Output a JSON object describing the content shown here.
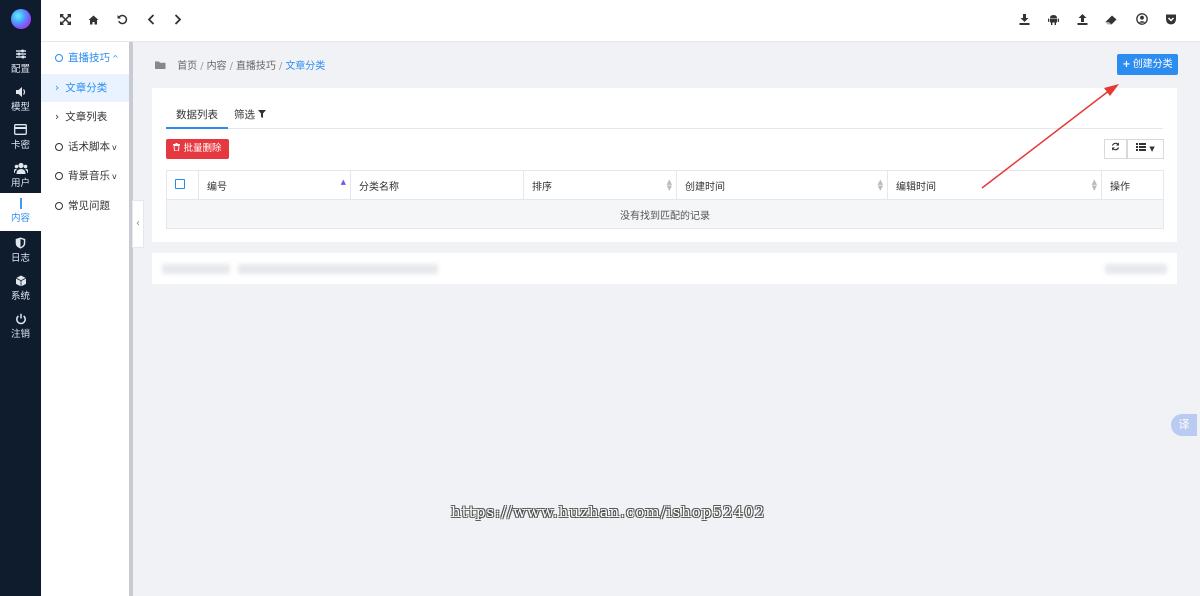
{
  "rail": {
    "items": [
      {
        "label": "配置",
        "icon": "sliders-icon"
      },
      {
        "label": "模型",
        "icon": "speaker-icon"
      },
      {
        "label": "卡密",
        "icon": "card-icon"
      },
      {
        "label": "用户",
        "icon": "users-icon"
      },
      {
        "label": "内容",
        "icon": "pen-icon"
      },
      {
        "label": "日志",
        "icon": "shield-icon"
      },
      {
        "label": "系统",
        "icon": "cube-icon"
      },
      {
        "label": "注销",
        "icon": "power-icon"
      }
    ],
    "active": "内容"
  },
  "submenu": {
    "items": [
      {
        "label": "直播技巧",
        "expand": "^"
      },
      {
        "label": "文章分类"
      },
      {
        "label": "文章列表"
      },
      {
        "label": "话术脚本",
        "expand": "v"
      },
      {
        "label": "背景音乐",
        "expand": "v"
      },
      {
        "label": "常见问题"
      }
    ],
    "collapse_glyph": "‹"
  },
  "topbar": {
    "icons": [
      "fullscreen-icon",
      "home-icon",
      "refresh-icon",
      "back-icon",
      "forward-icon",
      "download-icon",
      "android-icon",
      "upload-icon",
      "eraser-icon",
      "user-circle-icon",
      "pocket-icon"
    ]
  },
  "breadcrumb": {
    "items": [
      "首页",
      "内容",
      "直播技巧"
    ],
    "current": "文章分类",
    "separator": "/"
  },
  "create_button": {
    "label": "创建分类",
    "icon": "+"
  },
  "tabs": [
    {
      "label": "数据列表"
    },
    {
      "label": "筛选"
    }
  ],
  "batch_delete": {
    "label": "批量删除"
  },
  "table": {
    "columns": [
      "编号",
      "分类名称",
      "排序",
      "创建时间",
      "编辑时间",
      "操作"
    ],
    "empty_text": "没有找到匹配的记录"
  },
  "watermark": "https://www.huzhan.com/ishop52402",
  "translate_label": "译",
  "colors": {
    "rail_bg": "#0f1c2e",
    "accent": "#2d8cf0",
    "danger": "#e6383f",
    "page_bg": "#f0f2f5",
    "arrow": "#e53935"
  }
}
